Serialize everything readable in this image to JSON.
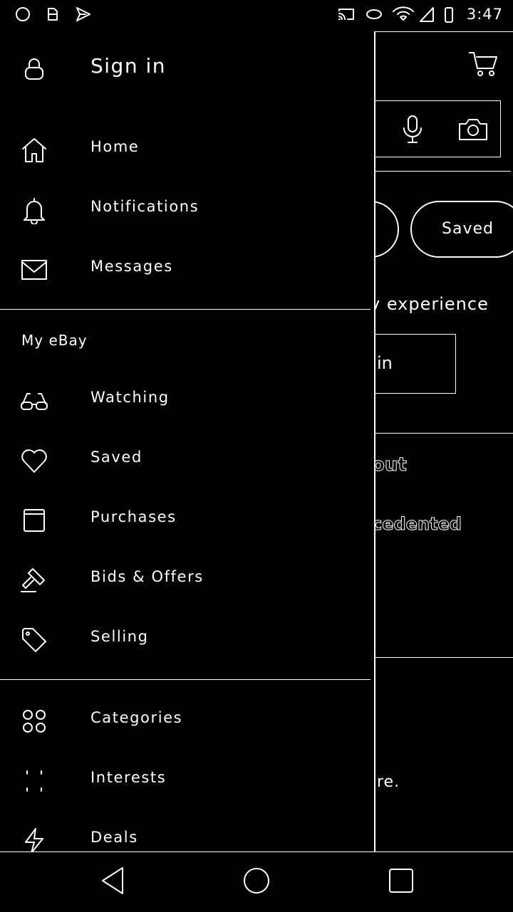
{
  "status_bar": {
    "time": "3:47",
    "left_icons": [
      "circle-icon",
      "sim-card-icon",
      "send-icon"
    ],
    "right_icons": [
      "cast-icon",
      "link-icon",
      "wifi-icon",
      "signal-icon",
      "battery-icon"
    ]
  },
  "background": {
    "chip_saved_label": "Saved",
    "promo_text_fragment": "y experience",
    "signin_fragment": "in",
    "bold_fragment_1": "out",
    "bold_fragment_2": "cedented",
    "text_fragment_3": "re."
  },
  "drawer": {
    "signin_label": "Sign in",
    "items_top": [
      {
        "label": "Home",
        "icon": "home-icon"
      },
      {
        "label": "Notifications",
        "icon": "bell-icon"
      },
      {
        "label": "Messages",
        "icon": "envelope-icon"
      }
    ],
    "section_my_ebay": "My eBay",
    "items_my_ebay": [
      {
        "label": "Watching",
        "icon": "glasses-icon"
      },
      {
        "label": "Saved",
        "icon": "heart-icon"
      },
      {
        "label": "Purchases",
        "icon": "box-icon"
      },
      {
        "label": "Bids & Offers",
        "icon": "gavel-icon"
      },
      {
        "label": "Selling",
        "icon": "tag-icon"
      }
    ],
    "items_bottom": [
      {
        "label": "Categories",
        "icon": "categories-icon"
      },
      {
        "label": "Interests",
        "icon": "interests-icon"
      },
      {
        "label": "Deals",
        "icon": "lightning-icon"
      }
    ]
  },
  "navbar": {
    "buttons": [
      "back-icon",
      "home-circle-icon",
      "recents-icon"
    ]
  }
}
